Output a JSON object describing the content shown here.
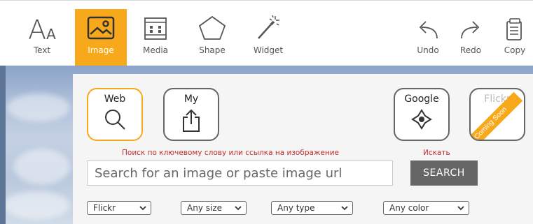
{
  "toolbar": {
    "items": [
      {
        "label": "Text",
        "icon": "text-icon"
      },
      {
        "label": "Image",
        "icon": "image-icon",
        "active": true
      },
      {
        "label": "Media",
        "icon": "media-icon"
      },
      {
        "label": "Shape",
        "icon": "shape-icon"
      },
      {
        "label": "Widget",
        "icon": "widget-icon"
      },
      {
        "label": "Undo",
        "icon": "undo-icon"
      },
      {
        "label": "Redo",
        "icon": "redo-icon"
      },
      {
        "label": "Copy",
        "icon": "copy-icon"
      }
    ],
    "text_icon_glyph_big": "A",
    "text_icon_glyph_small": "A"
  },
  "panel": {
    "sources": [
      {
        "label": "Web",
        "icon": "search-icon",
        "selected": true
      },
      {
        "label": "My",
        "icon": "upload-icon"
      },
      {
        "label": "Google",
        "icon": "google-icon"
      },
      {
        "label": "Flickr",
        "icon": "flickr-icon",
        "badge": "Coming Soon"
      }
    ],
    "hint_search": "Поиск по ключевому слову или ссылка на изображение",
    "hint_button": "Искать",
    "search_placeholder": "Search for an image or paste image url",
    "search_button": "SEARCH",
    "filters": [
      {
        "label": "Flickr"
      },
      {
        "label": "Any size"
      },
      {
        "label": "Any type"
      },
      {
        "label": "Any color"
      }
    ]
  },
  "colors": {
    "accent": "#f7a81b",
    "hint_red": "#c0302f",
    "search_button_bg": "#666666"
  }
}
